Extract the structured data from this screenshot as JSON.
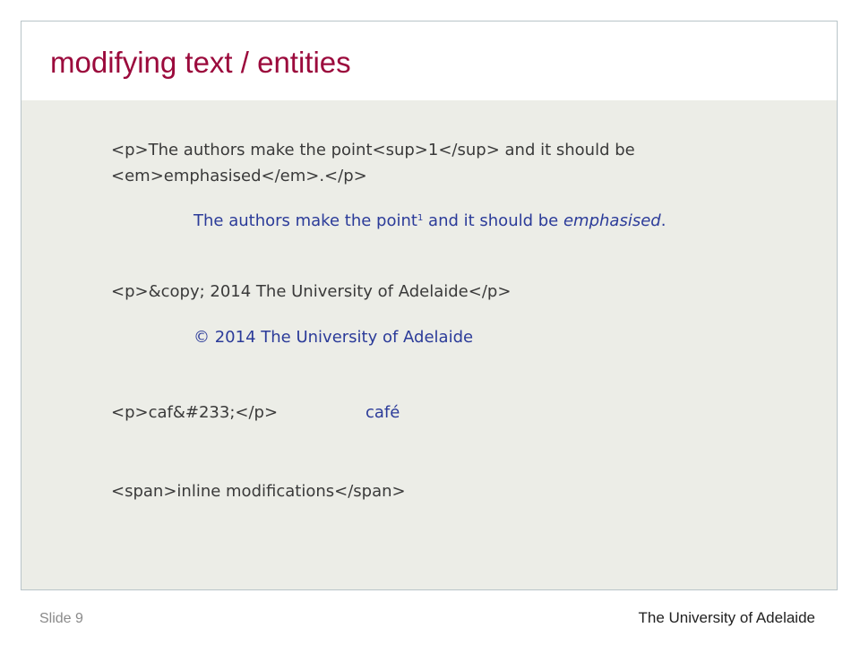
{
  "slide": {
    "title": "modifying text / entities",
    "footer_slide": "Slide 9",
    "footer_org": "The University of Adelaide"
  },
  "examples": {
    "sup_em": {
      "code_line1": "<p>The authors make the point<sup>1</sup> and it should be",
      "code_line2": "<em>emphasised</em>.</p>",
      "render_before_sup": "The authors make the point",
      "render_sup": "1",
      "render_middle": " and it should be ",
      "render_em": "emphasised",
      "render_end": "."
    },
    "copy": {
      "code": "<p>&copy; 2014 The University of Adelaide</p>",
      "render": "© 2014 The University of Adelaide"
    },
    "numeric": {
      "code": "<p>caf&#233;</p>",
      "render": "café"
    },
    "span": {
      "code": "<span>inline modifications</span>"
    }
  },
  "colors": {
    "title": "#9b0a3c",
    "code_text": "#3a3a3a",
    "render_text": "#2b3b99",
    "body_background": "#ecede7"
  }
}
